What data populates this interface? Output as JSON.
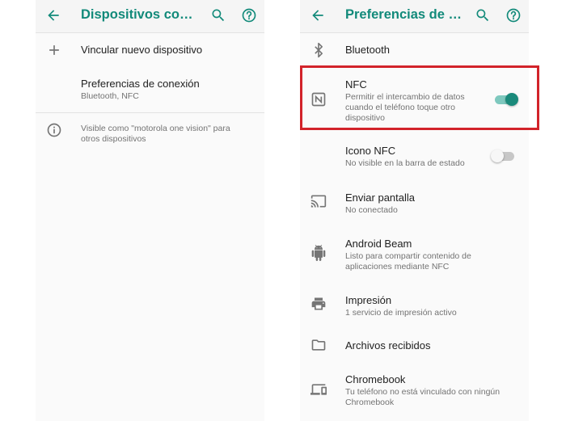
{
  "colors": {
    "accent": "#128a7a",
    "toggle_on": "#1a8a7b",
    "highlight_border": "#d2232a"
  },
  "left_screen": {
    "title": "Dispositivos conectados",
    "icons": [
      "arrow-back-icon",
      "search-icon",
      "help-circle-icon"
    ],
    "items": [
      {
        "icon": "plus-icon",
        "title": "Vincular nuevo dispositivo"
      },
      {
        "title": "Preferencias de conexión",
        "subtitle": "Bluetooth, NFC"
      }
    ],
    "footer": {
      "icon": "info-icon",
      "text": "Visible como \"motorola one vision\" para otros dispositivos"
    }
  },
  "right_screen": {
    "title": "Preferencias de conexión",
    "icons": [
      "arrow-back-icon",
      "search-icon",
      "help-circle-icon"
    ],
    "items": [
      {
        "icon": "bluetooth-icon",
        "title": "Bluetooth"
      },
      {
        "icon": "nfc-icon",
        "title": "NFC",
        "subtitle": "Permitir el intercambio de datos cuando el teléfono toque otro dispositivo",
        "toggle": "on"
      },
      {
        "title": "Icono NFC",
        "subtitle": "No visible en la barra de estado",
        "toggle": "off"
      },
      {
        "icon": "cast-icon",
        "title": "Enviar pantalla",
        "subtitle": "No conectado"
      },
      {
        "icon": "android-icon",
        "title": "Android Beam",
        "subtitle": "Listo para compartir contenido de aplicaciones mediante NFC"
      },
      {
        "icon": "printer-icon",
        "title": "Impresión",
        "subtitle": "1 servicio de impresión activo"
      },
      {
        "icon": "folder-icon",
        "title": "Archivos recibidos"
      },
      {
        "icon": "devices-icon",
        "title": "Chromebook",
        "subtitle": "Tu teléfono no está vinculado con ningún Chromebook"
      }
    ]
  }
}
